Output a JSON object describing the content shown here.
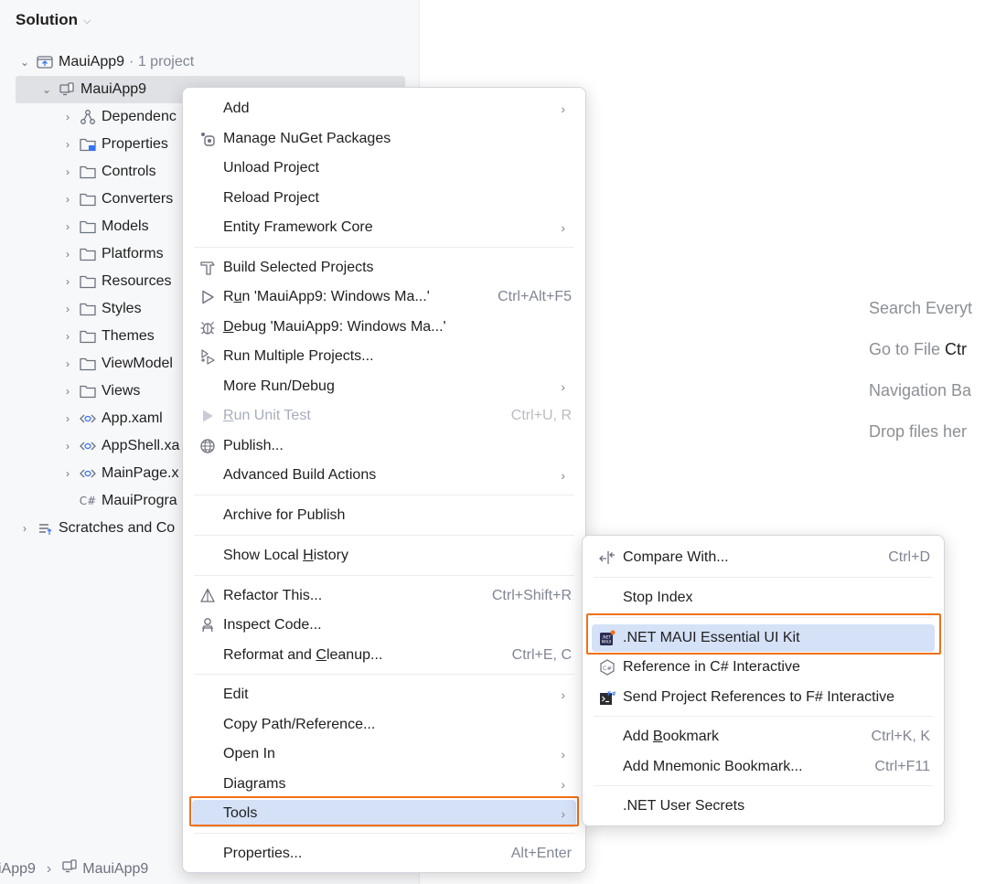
{
  "panel": {
    "title": "Solution",
    "tree": [
      {
        "label": "MauiApp9",
        "suffix": "· 1 project",
        "icon": "solution-icon",
        "expanded": true
      },
      {
        "label": "MauiApp9",
        "icon": "project-icon",
        "expanded": true,
        "selected": true
      },
      {
        "label": "Dependenc",
        "icon": "dependencies-icon"
      },
      {
        "label": "Properties",
        "icon": "properties-folder-icon"
      },
      {
        "label": "Controls",
        "icon": "folder-icon"
      },
      {
        "label": "Converters",
        "icon": "folder-icon"
      },
      {
        "label": "Models",
        "icon": "folder-icon"
      },
      {
        "label": "Platforms",
        "icon": "folder-icon"
      },
      {
        "label": "Resources",
        "icon": "folder-icon"
      },
      {
        "label": "Styles",
        "icon": "folder-icon"
      },
      {
        "label": "Themes",
        "icon": "folder-icon"
      },
      {
        "label": "ViewModel",
        "icon": "folder-icon"
      },
      {
        "label": "Views",
        "icon": "folder-icon"
      },
      {
        "label": "App.xaml",
        "icon": "xaml-file-icon"
      },
      {
        "label": "AppShell.xa",
        "icon": "xaml-file-icon"
      },
      {
        "label": "MainPage.x",
        "icon": "xaml-file-icon"
      },
      {
        "label": "MauiProgra",
        "icon": "csharp-file-icon"
      },
      {
        "label": "Scratches and Co",
        "icon": "scratches-icon"
      }
    ]
  },
  "hints": [
    {
      "text": "Search Everyt",
      "key": ""
    },
    {
      "text": "Go to File ",
      "key": "Ctr"
    },
    {
      "text": "Navigation Ba",
      "key": ""
    },
    {
      "text": "Drop files her",
      "key": ""
    }
  ],
  "statusbar": {
    "crumb1": "iApp9",
    "crumb2": "MauiApp9"
  },
  "menu": {
    "add": "Add",
    "manage_nuget": "Manage NuGet Packages",
    "unload": "Unload Project",
    "reload": "Reload Project",
    "ef_core": "Entity Framework Core",
    "build_selected": "Build Selected Projects",
    "run_pre": "R",
    "run_u": "u",
    "run_post": "n 'MauiApp9: Windows Ma...'",
    "run_short": "Ctrl+Alt+F5",
    "debug_u": "D",
    "debug_post": "ebug 'MauiApp9: Windows Ma...'",
    "run_multiple": "Run Multiple Projects...",
    "more_run": "More Run/Debug",
    "run_unit_u": "R",
    "run_unit_post": "un Unit Test",
    "run_unit_short": "Ctrl+U, R",
    "publish": "Publish...",
    "advanced_build": "Advanced Build Actions",
    "archive": "Archive for Publish",
    "local_history_pre": "Show Local ",
    "local_history_u": "H",
    "local_history_post": "istory",
    "refactor": "Refactor This...",
    "refactor_short": "Ctrl+Shift+R",
    "inspect": "Inspect Code...",
    "reformat_pre": "Reformat and ",
    "reformat_u": "C",
    "reformat_post": "leanup...",
    "reformat_short": "Ctrl+E, C",
    "edit": "Edit",
    "copy_path": "Copy Path/Reference...",
    "open_in": "Open In",
    "diagrams": "Diagrams",
    "tools": "Tools",
    "properties": "Properties...",
    "properties_short": "Alt+Enter"
  },
  "submenu": {
    "compare": "Compare With...",
    "compare_short": "Ctrl+D",
    "stop_index": "Stop Index",
    "maui_kit": ".NET MAUI Essential UI Kit",
    "ref_csharp": "Reference in C# Interactive",
    "send_fsharp": "Send Project References to F# Interactive",
    "bookmark_pre": "Add ",
    "bookmark_u": "B",
    "bookmark_post": "ookmark",
    "bookmark_short": "Ctrl+K, K",
    "mnemonic": "Add Mnemonic Bookmark...",
    "mnemonic_short": "Ctrl+F11",
    "user_secrets": ".NET User Secrets"
  },
  "colors": {
    "highlight_box": "#f0701a",
    "selection_bg": "#d5e1f7"
  }
}
